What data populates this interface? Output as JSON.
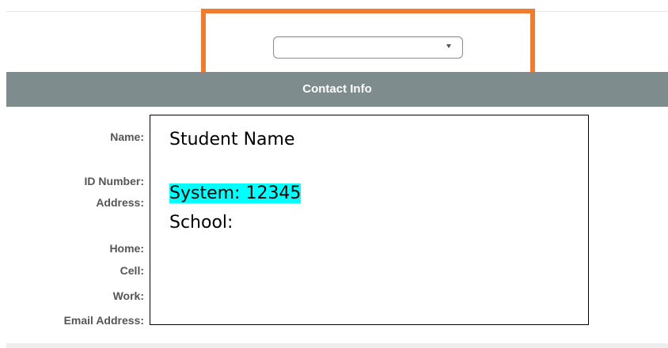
{
  "contact_info": {
    "section_title": "Contact Info",
    "labels": {
      "name": "Name:",
      "id_number": "ID Number:",
      "address": "Address:",
      "home": "Home:",
      "cell": "Cell:",
      "work": "Work:",
      "email": "Email Address:"
    }
  },
  "overlay": {
    "student_name": "Student Name",
    "system": "System: 12345",
    "school": "School:"
  },
  "colors": {
    "highlight_border": "#ee7d31",
    "header_bg": "#7f8c8d",
    "cyan_highlight": "#00ffff"
  }
}
